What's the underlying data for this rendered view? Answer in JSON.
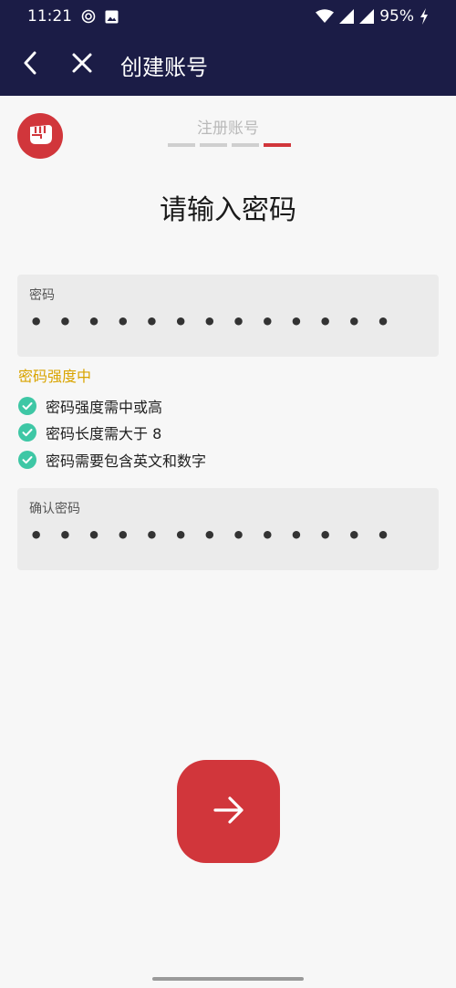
{
  "status_bar": {
    "time": "11:21",
    "battery": "95%",
    "icons": [
      "target-icon",
      "image-icon",
      "wifi-icon",
      "signal-icon",
      "signal-icon",
      "charging-bolt-icon"
    ]
  },
  "app_bar": {
    "title": "创建账号",
    "back_icon": "back-arrow-icon",
    "close_icon": "close-icon"
  },
  "brand": {
    "logo_icon": "fist-logo-icon",
    "accent": "#d1363b",
    "header_bg": "#1b1c46"
  },
  "step": {
    "label": "注册账号",
    "total": 4,
    "current": 4
  },
  "heading": "请输入密码",
  "password_field": {
    "label": "密码",
    "value": "• • • • • • • • • • • • •"
  },
  "strength": {
    "text": "密码强度中",
    "color": "#d9a400"
  },
  "rules": [
    {
      "text": "密码强度需中或高",
      "met": true
    },
    {
      "text": "密码长度需大于 8",
      "met": true
    },
    {
      "text": "密码需要包含英文和数字",
      "met": true
    }
  ],
  "confirm_field": {
    "label": "确认密码",
    "value": "• • • • • • • • • • • • •"
  },
  "next_button": {
    "icon": "arrow-right-icon"
  },
  "check_color": "#3ec7a5"
}
